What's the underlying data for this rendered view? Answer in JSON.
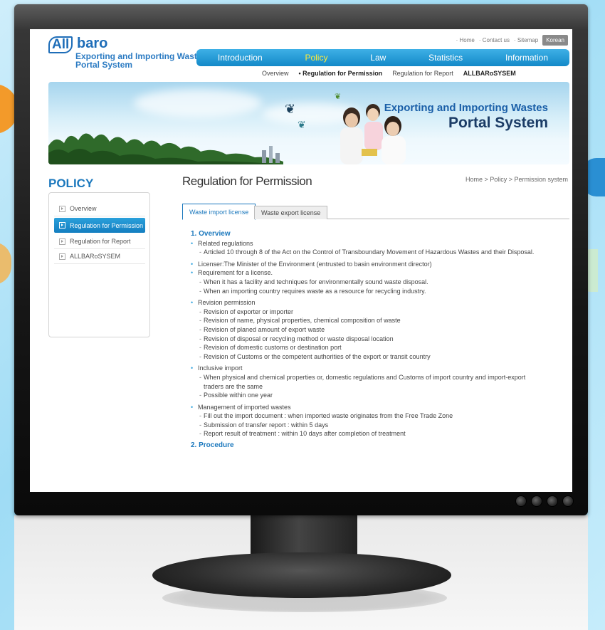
{
  "header": {
    "logo_all": "All",
    "logo_baro": "baro",
    "logo_sub1": "Exporting and Importing Wastes",
    "logo_sub2": "Portal System",
    "util": {
      "home": "· Home",
      "contact": "· Contact us",
      "sitemap": "· Sitemap",
      "korean": "Korean"
    },
    "gnb": [
      "Introduction",
      "Policy",
      "Law",
      "Statistics",
      "Information"
    ],
    "lnb": [
      "Overview",
      "• Regulation for Permission",
      "Regulation for Report",
      "ALLBARoSYSEM"
    ]
  },
  "banner": {
    "line1": "Exporting and Importing Wastes",
    "line2": "Portal System"
  },
  "sidebar": {
    "title": "POLICY",
    "items": [
      {
        "label": "Overview"
      },
      {
        "label": "Regulation for Permission"
      },
      {
        "label": "Regulation for Report"
      },
      {
        "label": "ALLBARoSYSEM"
      }
    ]
  },
  "main": {
    "title": "Regulation for Permission",
    "breadcrumb": "Home > Policy > Permission system",
    "tabs": [
      "Waste import license",
      "Waste export license"
    ],
    "section1": "1. Overview",
    "related": "Related regulations",
    "related_sub": "Articled  10 through 8 of the Act on the Control of Transboundary Movement of Hazardous Wastes and their Disposal.",
    "licenser": "Licenser:The Minister of the Environment (entrusted to basin environment director)",
    "requirement": "Requirement for a license.",
    "req_sub": [
      "When it has a facility and techniques for environmentally sound waste disposal.",
      "When an importing country requires waste as a resource for recycling industry."
    ],
    "revision": "Revision permission",
    "rev_sub": [
      "Revision of exporter or importer",
      "Revision of name, physical properties, chemical composition of waste",
      "Revision of planed amount of export waste",
      "Revision of disposal or recycling method or waste disposal location",
      "Revision of domestic customs or destination port",
      "Revision of  Customs or the competent authorities of the export or transit country"
    ],
    "inclusive": "Inclusive import",
    "inc_sub1a": "When physical and chemical properties or, domestic regulations and Customs of import country and import-export",
    "inc_sub1b": "traders are the same",
    "inc_sub2": "Possible within one year",
    "management": "Management of imported wastes",
    "man_sub": [
      "Fill out the import document : when imported waste originates from the Free Trade Zone",
      "Submission of transfer report : within 5 days",
      "Report result of treatment : within 10 days after completion of treatment"
    ],
    "section2": "2. Procedure"
  }
}
